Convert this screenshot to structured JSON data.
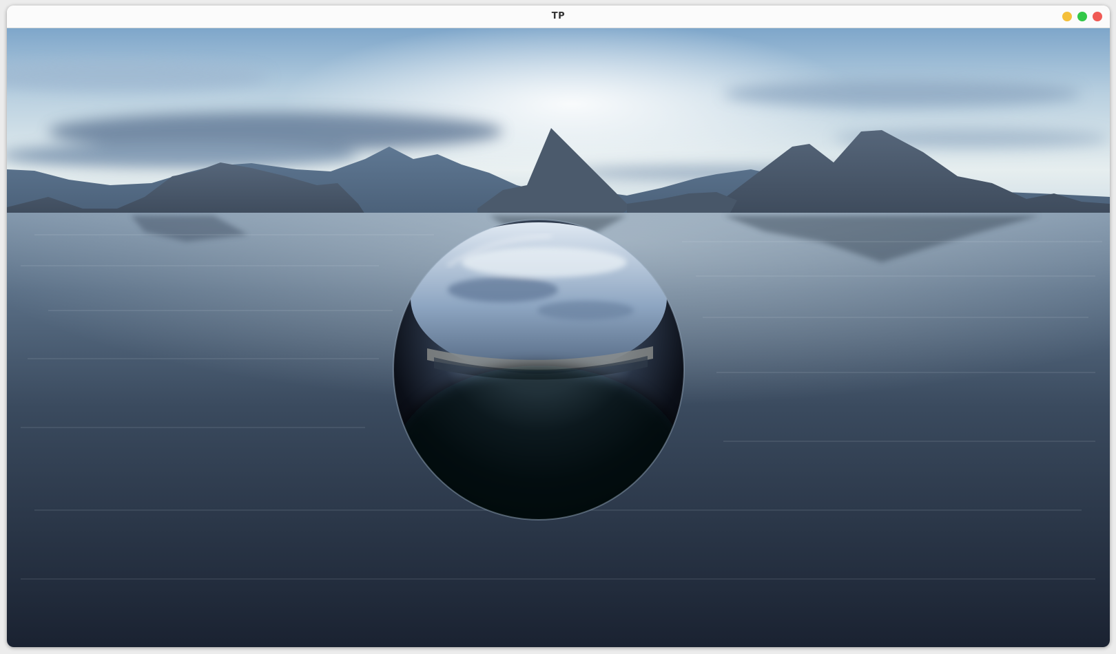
{
  "window": {
    "title": "TP"
  },
  "controls": [
    {
      "name": "minimize-button",
      "color": "#f4bf3a"
    },
    {
      "name": "maximize-button",
      "color": "#33c748"
    },
    {
      "name": "close-button",
      "color": "#f05a55"
    }
  ],
  "scene": {
    "description_icons": [
      "sky-skybox",
      "mountain-range",
      "water-plane",
      "reflective-sphere"
    ],
    "colors": {
      "sky_top": "#8fb4d4",
      "sky_horizon": "#eef3f2",
      "mountain": "#4a5a6e",
      "water_near": "#1c2635",
      "water_far": "#6f8aa6",
      "sphere_dark": "#05070c"
    }
  }
}
